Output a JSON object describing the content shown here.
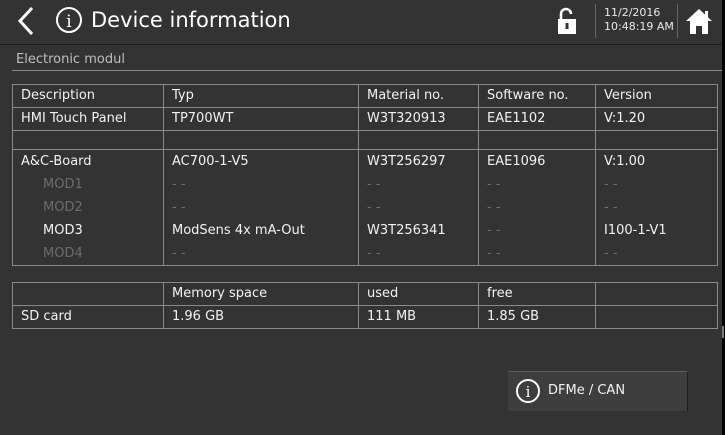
{
  "header": {
    "title": "Device information",
    "date": "11/2/2016",
    "time": "10:48:19 AM",
    "back_icon": "chevron-left",
    "info_icon": "info-circle",
    "lock_icon": "padlock-open",
    "home_icon": "house"
  },
  "section": {
    "title": "Electronic modul"
  },
  "table": {
    "headers": [
      "Description",
      "Typ",
      "Material no.",
      "Software no.",
      "Version"
    ],
    "hmi": [
      "HMI Touch Panel",
      "TP700WT",
      "W3T320913",
      "EAE1102",
      "V:1.20"
    ],
    "board": [
      "A&C-Board",
      "AC700-1-V5",
      "W3T256297",
      "EAE1096",
      "V:1.00"
    ],
    "mod1": [
      "MOD1",
      "- -",
      "- -",
      "- -",
      "- -"
    ],
    "mod2": [
      "MOD2",
      "- -",
      "- -",
      "- -",
      "- -"
    ],
    "mod3": [
      "MOD3",
      "ModSens 4x mA-Out",
      "W3T256341",
      "- -",
      "I100-1-V1"
    ],
    "mod4": [
      "MOD4",
      "- -",
      "- -",
      "- -",
      "- -"
    ],
    "memory_headers": [
      "",
      "Memory space",
      "used",
      "free",
      ""
    ],
    "sd": [
      "SD card",
      "1.96 GB",
      "111 MB",
      "1.85 GB",
      ""
    ]
  },
  "button": {
    "label": "DFMe / CAN",
    "icon": "info-circle"
  },
  "colors": {
    "background": "#333333",
    "border": "#8a8a8a",
    "text": "#f2f2f2",
    "dim_text": "#6c6c6c"
  }
}
